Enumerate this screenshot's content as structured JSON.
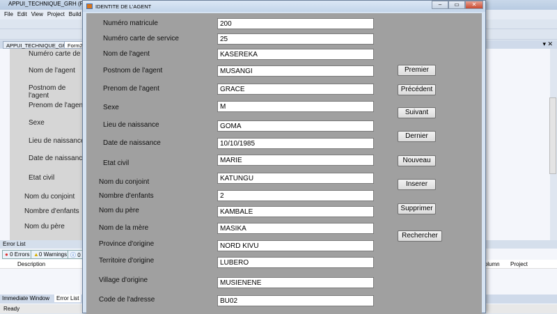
{
  "ide": {
    "title": "APPUI_TECHNIQUE_GRH (Running)",
    "menu": [
      "File",
      "Edit",
      "View",
      "Project",
      "Build"
    ],
    "tabs": [
      "APPUI_TECHNIQUE_GRH",
      "Form2"
    ],
    "designer_labels": [
      "Numéro carte de s",
      "Nom de l'agent",
      "Postnom de l'agent",
      "Prenom de l'agent",
      "Sexe",
      "Lieu de naissance",
      "Date de naissance",
      "Etat civil",
      "Nom du conjoint",
      "Nombre d'enfants",
      "Nom du père"
    ],
    "error_list": {
      "title": "Error List",
      "errors": "0 Errors",
      "warnings": "0 Warnings",
      "messages": "0",
      "col_description": "Description",
      "col_column": "Column",
      "col_project": "Project"
    },
    "bottom_tabs": [
      "Immediate Window",
      "Error List"
    ],
    "status": "Ready"
  },
  "dialog": {
    "title": "IDENTITE DE L'AGENT",
    "fields": [
      {
        "label": "Numéro matricule",
        "value": "200"
      },
      {
        "label": "Numéro carte de service",
        "value": "25"
      },
      {
        "label": "Nom de l'agent",
        "value": "KASEREKA"
      },
      {
        "label": "Postnom de l'agent",
        "value": "MUSANGI"
      },
      {
        "label": "Prenom de l'agent",
        "value": "GRACE"
      },
      {
        "label": "Sexe",
        "value": "M"
      },
      {
        "label": "Lieu de naissance",
        "value": "GOMA"
      },
      {
        "label": "Date de naissance",
        "value": "10/10/1985"
      },
      {
        "label": "Etat civil",
        "value": "MARIE"
      },
      {
        "label": "Nom du conjoint",
        "value": "KATUNGU"
      },
      {
        "label": "Nombre d'enfants",
        "value": "2"
      },
      {
        "label": "Nom du père",
        "value": "KAMBALE"
      },
      {
        "label": "Nom de la mère",
        "value": "MASIKA"
      },
      {
        "label": "Province d'origine",
        "value": "NORD KIVU"
      },
      {
        "label": "Territoire d'origine",
        "value": "LUBERO"
      },
      {
        "label": "Village d'origine",
        "value": "MUSIENENE"
      },
      {
        "label": "Code de l'adresse",
        "value": "BU02"
      }
    ],
    "buttons": [
      "Premier",
      "Précédent",
      "Suivant",
      "Dernier",
      "Nouveau",
      "Inserer",
      "Supprimer",
      "Rechercher"
    ]
  }
}
